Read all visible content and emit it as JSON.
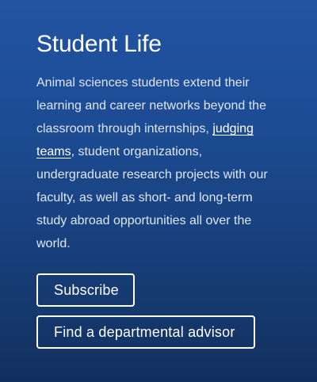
{
  "section": {
    "title": "Student Life",
    "paragraph_before_link": "Animal sciences students extend their learning and career networks beyond the classroom through internships, ",
    "link_text": "judging teams",
    "paragraph_after_link": ", student organizations, undergraduate research projects with our faculty, as well as short- and long-term study abroad opportunities all over the world."
  },
  "buttons": {
    "subscribe_label": "Subscribe",
    "advisor_label": "Find a departmental advisor"
  },
  "colors": {
    "background_top": "#2254a4",
    "background_bottom": "#12305e",
    "text": "#dfe6f3",
    "button_border": "#ffffff"
  }
}
